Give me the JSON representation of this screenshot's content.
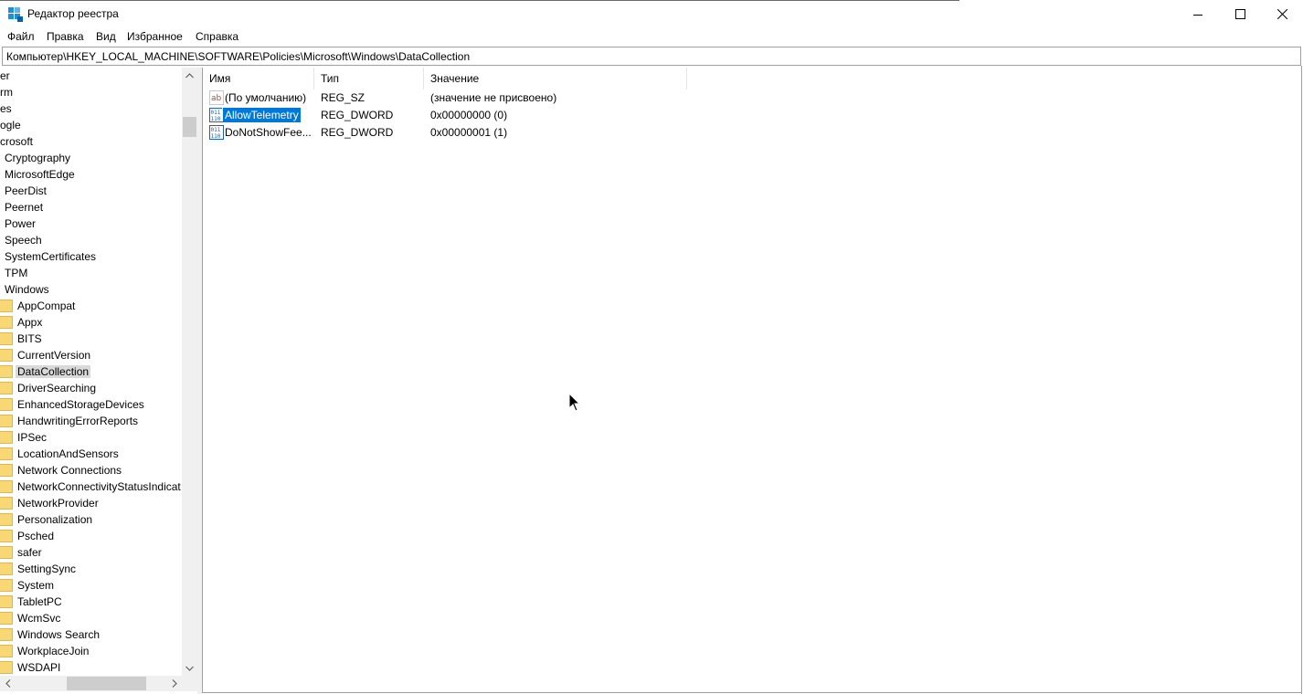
{
  "window": {
    "title": "Редактор реестра",
    "icon": "registry-editor-icon",
    "controls": [
      "minimize-icon",
      "maximize-icon",
      "close-icon"
    ]
  },
  "menu": [
    "Файл",
    "Правка",
    "Вид",
    "Избранное",
    "Справка"
  ],
  "address": "Компьютер\\HKEY_LOCAL_MACHINE\\SOFTWARE\\Policies\\Microsoft\\Windows\\DataCollection",
  "tree": {
    "items": [
      {
        "label": "er",
        "level": 0
      },
      {
        "label": "rm",
        "level": 0
      },
      {
        "label": "es",
        "level": 0
      },
      {
        "label": "ogle",
        "level": 0
      },
      {
        "label": "crosoft",
        "level": 0
      },
      {
        "label": "Cryptography",
        "level": 1
      },
      {
        "label": "MicrosoftEdge",
        "level": 1
      },
      {
        "label": "PeerDist",
        "level": 1
      },
      {
        "label": "Peernet",
        "level": 1
      },
      {
        "label": "Power",
        "level": 1
      },
      {
        "label": "Speech",
        "level": 1
      },
      {
        "label": "SystemCertificates",
        "level": 1
      },
      {
        "label": "TPM",
        "level": 1
      },
      {
        "label": "Windows",
        "level": 1
      },
      {
        "label": "AppCompat",
        "level": 2
      },
      {
        "label": "Appx",
        "level": 2
      },
      {
        "label": "BITS",
        "level": 2
      },
      {
        "label": "CurrentVersion",
        "level": 2
      },
      {
        "label": "DataCollection",
        "level": 2,
        "selected": true
      },
      {
        "label": "DriverSearching",
        "level": 2
      },
      {
        "label": "EnhancedStorageDevices",
        "level": 2
      },
      {
        "label": "HandwritingErrorReports",
        "level": 2
      },
      {
        "label": "IPSec",
        "level": 2
      },
      {
        "label": "LocationAndSensors",
        "level": 2
      },
      {
        "label": "Network Connections",
        "level": 2
      },
      {
        "label": "NetworkConnectivityStatusIndicat",
        "level": 2
      },
      {
        "label": "NetworkProvider",
        "level": 2
      },
      {
        "label": "Personalization",
        "level": 2
      },
      {
        "label": "Psched",
        "level": 2
      },
      {
        "label": "safer",
        "level": 2
      },
      {
        "label": "SettingSync",
        "level": 2
      },
      {
        "label": "System",
        "level": 2
      },
      {
        "label": "TabletPC",
        "level": 2
      },
      {
        "label": "WcmSvc",
        "level": 2
      },
      {
        "label": "Windows Search",
        "level": 2
      },
      {
        "label": "WorkplaceJoin",
        "level": 2
      },
      {
        "label": "WSDAPI",
        "level": 2
      }
    ]
  },
  "values": {
    "columns": [
      "Имя",
      "Тип",
      "Значение"
    ],
    "rows": [
      {
        "name": "(По умолчанию)",
        "type": "REG_SZ",
        "data": "(значение не присвоено)",
        "icon": "string-value-icon"
      },
      {
        "name": "AllowTelemetry",
        "type": "REG_DWORD",
        "data": "0x00000000 (0)",
        "icon": "binary-value-icon",
        "selected": true
      },
      {
        "name": "DoNotShowFee...",
        "type": "REG_DWORD",
        "data": "0x00000001 (1)",
        "icon": "binary-value-icon"
      }
    ]
  },
  "colors": {
    "selection": "#0078d7",
    "tree_selection": "#d9d9d9",
    "folder": "#f8d775"
  }
}
